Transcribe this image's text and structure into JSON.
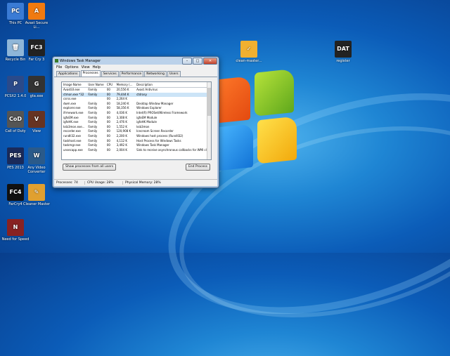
{
  "desktop_icons": [
    {
      "label": "This PC",
      "glyph": "PC",
      "color": "#3a7bd5"
    },
    {
      "label": "Avast Secure Li...",
      "glyph": "A",
      "color": "#f07a10"
    },
    {
      "label": "Recycle Bin",
      "glyph": "🗑",
      "color": "#8fb6d8"
    },
    {
      "label": "Far Cry 3",
      "glyph": "FC3",
      "color": "#222"
    },
    {
      "label": "PCSX2 1.4.0",
      "glyph": "P",
      "color": "#2a4a8a"
    },
    {
      "label": "gta.exe",
      "glyph": "G",
      "color": "#333"
    },
    {
      "label": "Call of Duty",
      "glyph": "CoD",
      "color": "#555"
    },
    {
      "label": "View",
      "glyph": "V",
      "color": "#663322"
    },
    {
      "label": "PES 2013",
      "glyph": "PES",
      "color": "#1a2a5a"
    },
    {
      "label": "Any Video Converter",
      "glyph": "W",
      "color": "#2a5a8a"
    },
    {
      "label": "FarCry4",
      "glyph": "FC4",
      "color": "#111"
    },
    {
      "label": "Cleaner Master",
      "glyph": "✎",
      "color": "#e0a030"
    },
    {
      "label": "Need for Speed",
      "glyph": "N",
      "color": "#882222"
    },
    {
      "label": "clean-master...",
      "glyph": "✓",
      "color": "#f0b030"
    },
    {
      "label": "register",
      "glyph": "DAT",
      "color": "#222"
    }
  ],
  "window": {
    "title": "Windows Task Manager",
    "menu": [
      "File",
      "Options",
      "View",
      "Help"
    ],
    "tabs": [
      "Applications",
      "Processes",
      "Services",
      "Performance",
      "Networking",
      "Users"
    ],
    "active_tab": "Processes",
    "columns": [
      "Image Name",
      "User Name",
      "CPU",
      "Memory (...",
      "Description"
    ],
    "rows": [
      [
        "AvastUI.exe",
        "Family",
        "00",
        "20,556 K",
        "Avast Antivirus"
      ],
      [
        "ctmon.exe *32",
        "Family",
        "00",
        "79,444 K",
        "ctdrasy"
      ],
      [
        "csrss.exe",
        "",
        "00",
        "2,264 K",
        ""
      ],
      [
        "dwm.exe",
        "Family",
        "00",
        "18,240 K",
        "Desktop Window Manager"
      ],
      [
        "explorer.exe",
        "Family",
        "00",
        "58,356 K",
        "Windows Explorer"
      ],
      [
        "ifrmework.exe",
        "Family",
        "00",
        "4,036 K",
        "Intel(R) PROSet/Wireless Framework"
      ],
      [
        "igfxEM.exe",
        "Family",
        "00",
        "3,308 K",
        "igfxEM Module"
      ],
      [
        "igfxHK.exe",
        "Family",
        "00",
        "2,476 K",
        "igfxHK Module"
      ],
      [
        "ksb3mon.exe...",
        "Family",
        "00",
        "1,552 K",
        "ksb3mon"
      ],
      [
        "recorder.exe",
        "Family",
        "00",
        "120,908 K",
        "Icecream Screen Recorder"
      ],
      [
        "rundll32.exe",
        "Family",
        "00",
        "2,200 K",
        "Windows host process (Rundll32)"
      ],
      [
        "taskhost.exe",
        "Family",
        "00",
        "4,112 K",
        "Host Process for Windows Tasks"
      ],
      [
        "taskmgr.exe",
        "Family",
        "00",
        "3,492 K",
        "Windows Task Manager"
      ],
      [
        "unsecapp.exe",
        "Family",
        "00",
        "2,004 K",
        "Sink to receive asynchronous callbacks for WMI clier"
      ]
    ],
    "show_all_label": "Show processes from all users",
    "end_process_label": "End Process",
    "status": {
      "processes": "Processes: 74",
      "cpu": "CPU Usage: 28%",
      "memory": "Physical Memory: 28%"
    }
  }
}
